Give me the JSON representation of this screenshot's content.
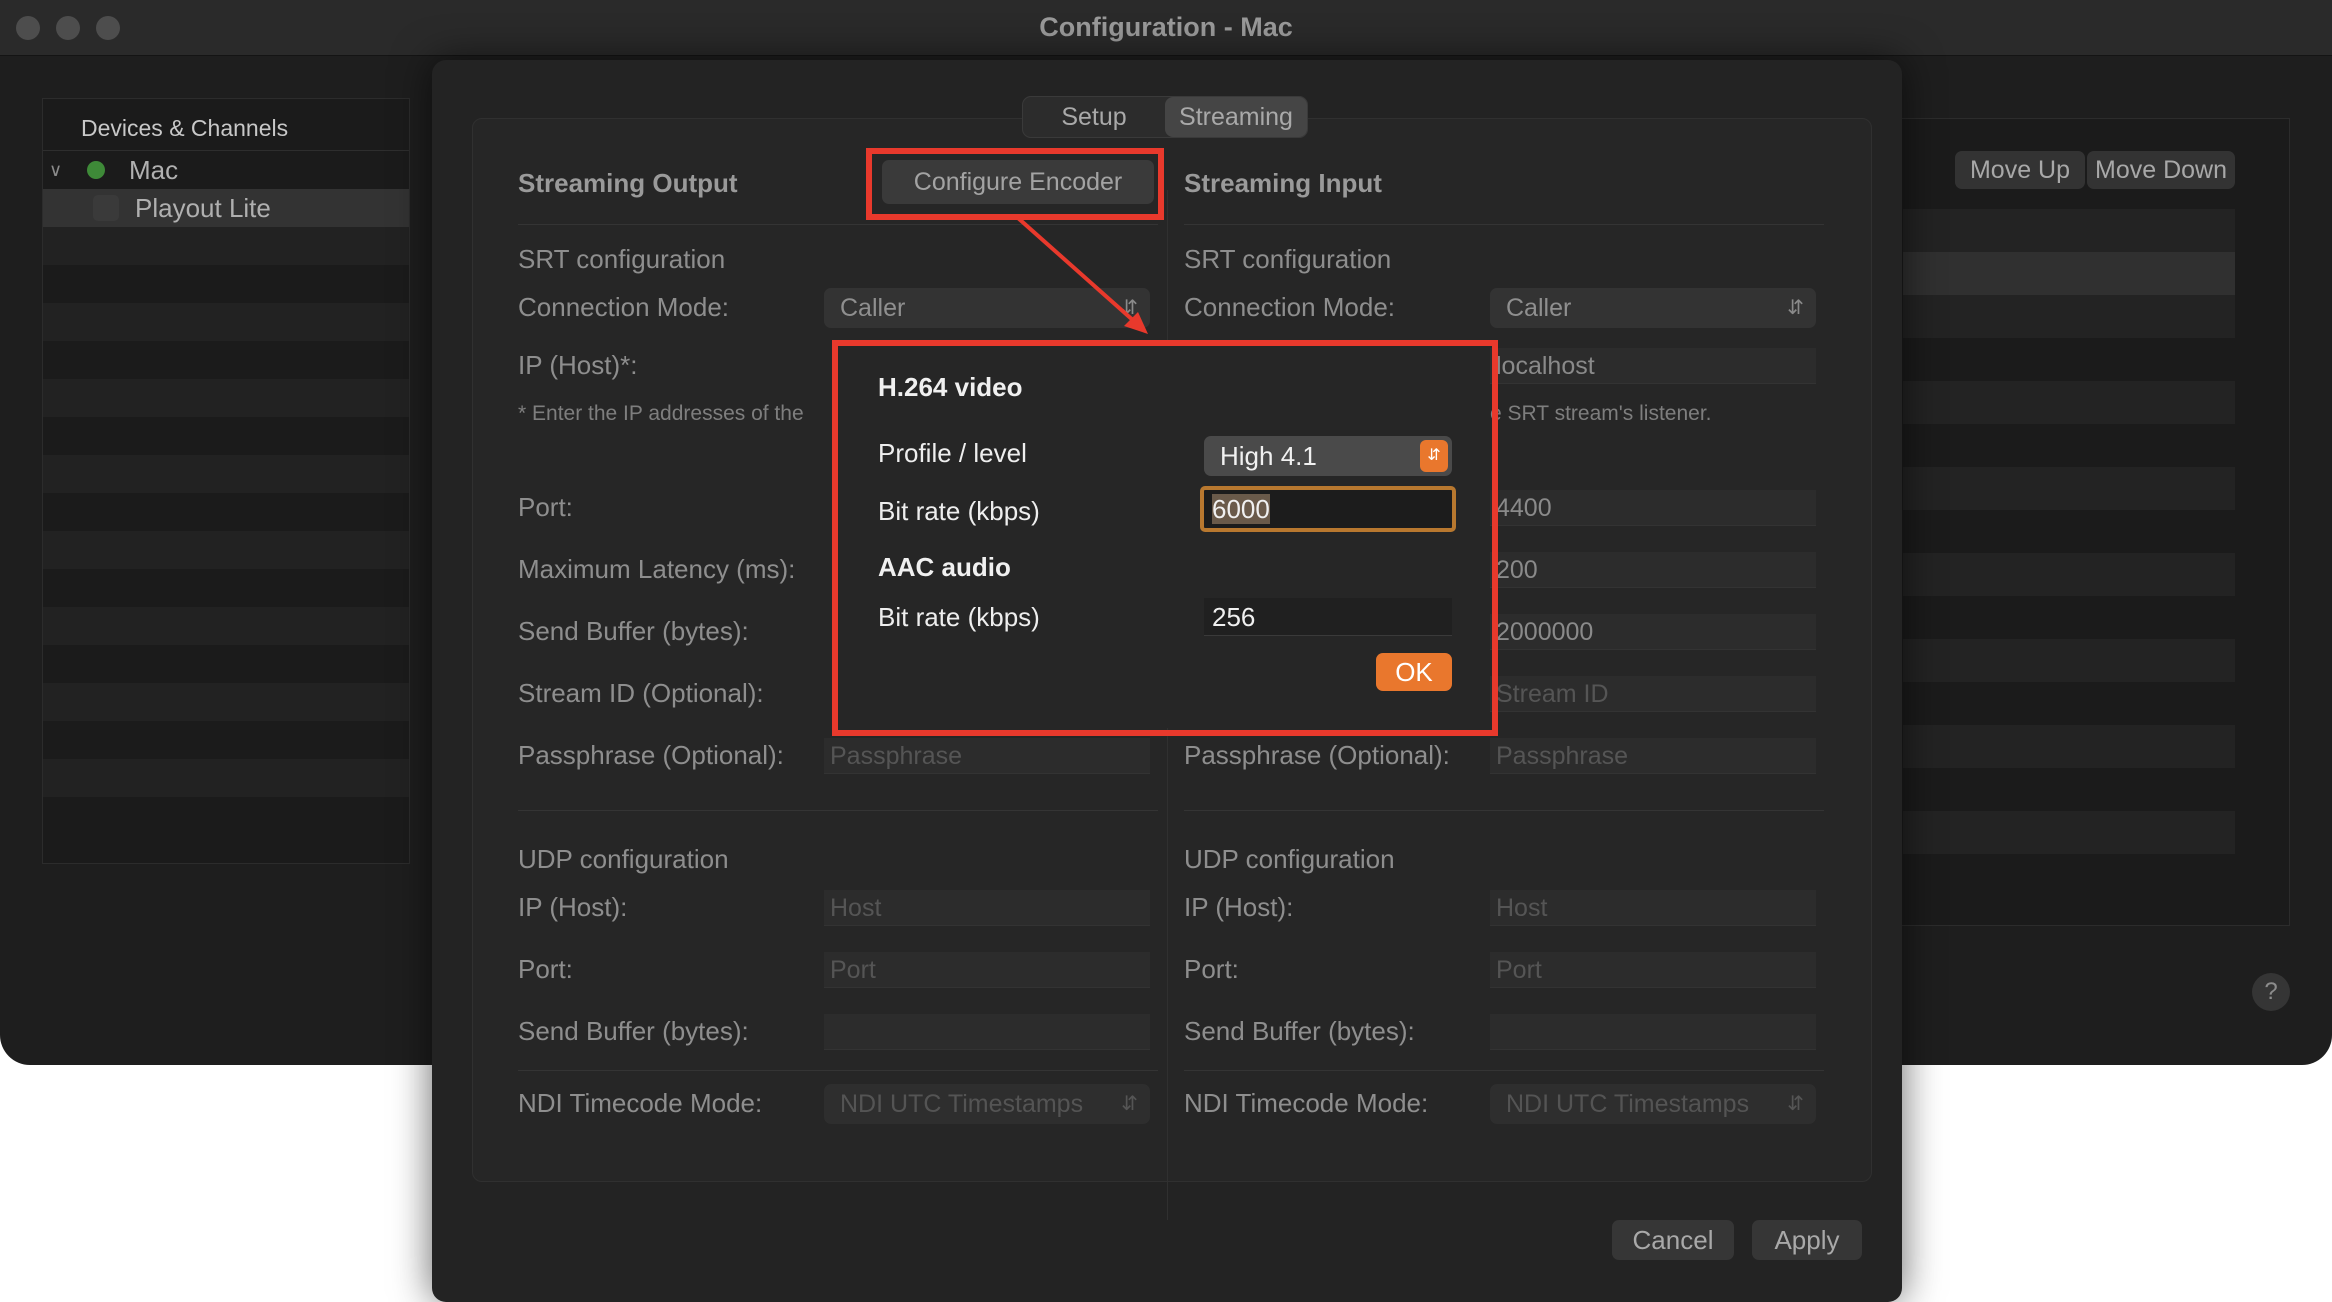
{
  "window": {
    "title": "Configuration - Mac"
  },
  "sidebar": {
    "header": "Devices & Channels",
    "items": [
      {
        "label": "Mac"
      },
      {
        "label": "Playout Lite"
      }
    ]
  },
  "list_controls": {
    "move_up": "Move Up",
    "move_down": "Move Down",
    "help": "?"
  },
  "tabs": [
    {
      "label": "Setup"
    },
    {
      "label": "Streaming"
    }
  ],
  "output": {
    "title": "Streaming Output",
    "configure_button": "Configure Encoder",
    "srt_heading": "SRT configuration",
    "connection_mode_label": "Connection Mode:",
    "connection_mode_value": "Caller",
    "ip_label": "IP (Host)*:",
    "note": "* Enter the IP addresses of the",
    "port_label": "Port:",
    "latency_label": "Maximum Latency (ms):",
    "send_buffer_label": "Send Buffer (bytes):",
    "stream_id_label": "Stream ID (Optional):",
    "passphrase_label": "Passphrase (Optional):",
    "passphrase_placeholder": "Passphrase",
    "udp_heading": "UDP configuration",
    "udp_ip_label": "IP (Host):",
    "udp_ip_placeholder": "Host",
    "udp_port_label": "Port:",
    "udp_port_placeholder": "Port",
    "udp_send_buffer_label": "Send Buffer (bytes):",
    "ndi_label": "NDI Timecode Mode:",
    "ndi_value": "NDI UTC Timestamps"
  },
  "input": {
    "title": "Streaming Input",
    "srt_heading": "SRT configuration",
    "connection_mode_label": "Connection Mode:",
    "connection_mode_value": "Caller",
    "ip_value": "localhost",
    "note": "e SRT stream's listener.",
    "port_value": "4400",
    "latency_value": "200",
    "send_buffer_value": "2000000",
    "stream_id_placeholder": "Stream ID",
    "passphrase_label": "Passphrase (Optional):",
    "passphrase_placeholder": "Passphrase",
    "udp_heading": "UDP configuration",
    "udp_ip_label": "IP (Host):",
    "udp_ip_placeholder": "Host",
    "udp_port_label": "Port:",
    "udp_port_placeholder": "Port",
    "udp_send_buffer_label": "Send Buffer (bytes):",
    "ndi_label": "NDI Timecode Mode:",
    "ndi_value": "NDI UTC Timestamps"
  },
  "encoder": {
    "video_heading": "H.264 video",
    "profile_label": "Profile / level",
    "profile_value": "High 4.1",
    "video_bitrate_label": "Bit rate (kbps)",
    "video_bitrate_value": "6000",
    "audio_heading": "AAC audio",
    "audio_bitrate_label": "Bit rate (kbps)",
    "audio_bitrate_value": "256",
    "ok": "OK"
  },
  "footer": {
    "cancel": "Cancel",
    "apply": "Apply"
  },
  "colors": {
    "highlight": "#e8392c",
    "accent": "#e9772d",
    "status_green": "#3e8a38"
  }
}
